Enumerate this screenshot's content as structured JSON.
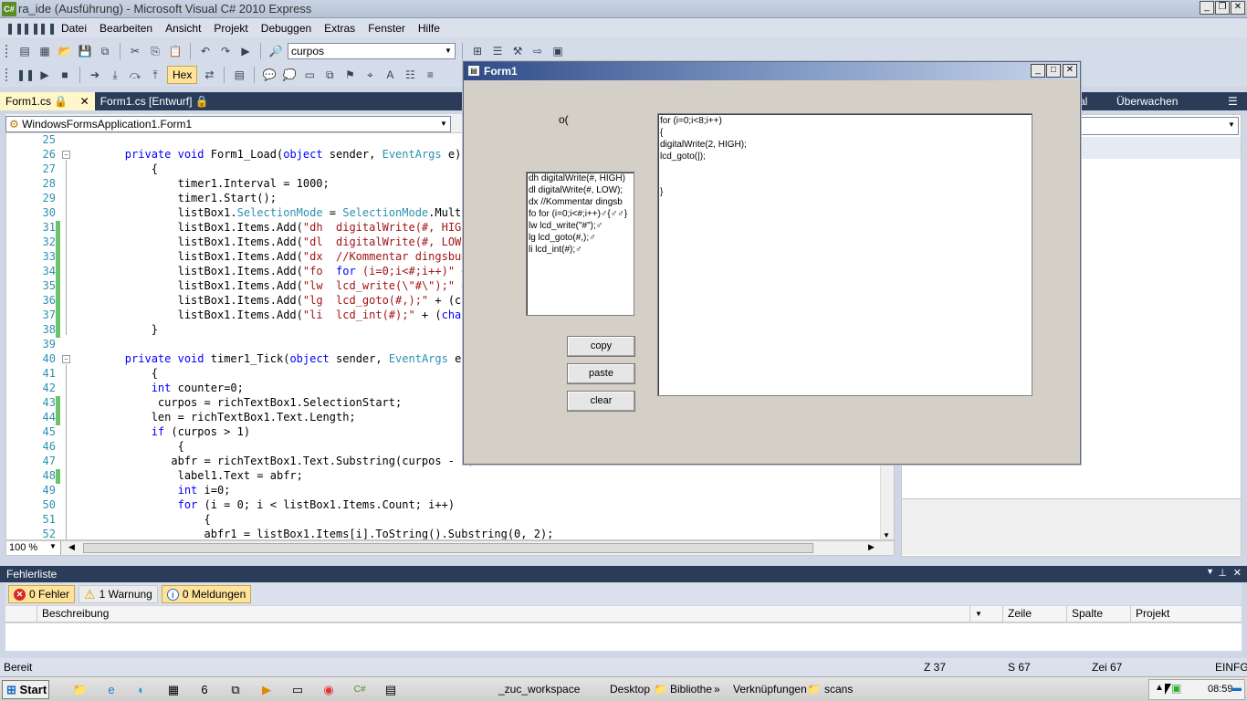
{
  "window": {
    "title": "ra_ide (Ausführung) - Microsoft Visual C# 2010 Express",
    "logo": "C#"
  },
  "menu": [
    "Datei",
    "Bearbeiten",
    "Ansicht",
    "Projekt",
    "Debuggen",
    "Extras",
    "Fenster",
    "Hilfe"
  ],
  "toolbar": {
    "find_value": "curpos",
    "hex_label": "Hex"
  },
  "doc_tabs": [
    {
      "label": "Form1.cs",
      "active": true
    },
    {
      "label": "Form1.cs [Entwurf]",
      "active": false
    }
  ],
  "navigator": {
    "class_combo": "WindowsFormsApplication1.Form1"
  },
  "editor": {
    "zoom": "100 %",
    "lines": [
      {
        "n": "25",
        "code": ""
      },
      {
        "n": "26",
        "code": "        private void Form1_Load(object sender, EventArgs e)"
      },
      {
        "n": "27",
        "code": "            {"
      },
      {
        "n": "28",
        "code": "                timer1.Interval = 1000;"
      },
      {
        "n": "29",
        "code": "                timer1.Start();"
      },
      {
        "n": "30",
        "code": "                listBox1.SelectionMode = SelectionMode.Multi"
      },
      {
        "n": "31",
        "code": "                listBox1.Items.Add(\"dh  digitalWrite(#, HIGH"
      },
      {
        "n": "32",
        "code": "                listBox1.Items.Add(\"dl  digitalWrite(#, LOW)"
      },
      {
        "n": "33",
        "code": "                listBox1.Items.Add(\"dx  //Kommentar dingsbum"
      },
      {
        "n": "34",
        "code": "                listBox1.Items.Add(\"fo  for (i=0;i<#;i++)\" +"
      },
      {
        "n": "35",
        "code": "                listBox1.Items.Add(\"lw  lcd_write(\\\"#\\\");\" +"
      },
      {
        "n": "36",
        "code": "                listBox1.Items.Add(\"lg  lcd_goto(#,);\" + (ch"
      },
      {
        "n": "37",
        "code": "                listBox1.Items.Add(\"li  lcd_int(#);\" + (char"
      },
      {
        "n": "38",
        "code": "            }"
      },
      {
        "n": "39",
        "code": ""
      },
      {
        "n": "40",
        "code": "        private void timer1_Tick(object sender, EventArgs e)"
      },
      {
        "n": "41",
        "code": "            {"
      },
      {
        "n": "42",
        "code": "            int counter=0;"
      },
      {
        "n": "43",
        "code": "             curpos = richTextBox1.SelectionStart;"
      },
      {
        "n": "44",
        "code": "            len = richTextBox1.Text.Length;"
      },
      {
        "n": "45",
        "code": "            if (curpos > 1)"
      },
      {
        "n": "46",
        "code": "                {"
      },
      {
        "n": "47",
        "code": "               abfr = richTextBox1.Text.Substring(curpos - 2,"
      },
      {
        "n": "48",
        "code": "                label1.Text = abfr;"
      },
      {
        "n": "49",
        "code": "                int i=0;"
      },
      {
        "n": "50",
        "code": "                for (i = 0; i < listBox1.Items.Count; i++)"
      },
      {
        "n": "51",
        "code": "                    {"
      },
      {
        "n": "52",
        "code": "                    abfr1 = listBox1.Items[i].ToString().Substring(0, 2);"
      }
    ]
  },
  "right_panel": {
    "tab_partial": "al",
    "tab_watch": "Überwachen"
  },
  "error_list": {
    "title": "Fehlerliste",
    "errors": "0 Fehler",
    "warnings": "1 Warnung",
    "messages": "0 Meldungen",
    "columns": [
      "Beschreibung",
      "Zeile",
      "Spalte",
      "Projekt"
    ]
  },
  "status": {
    "text": "Bereit",
    "line": "Z 37",
    "col": "S 67",
    "char": "Zei 67",
    "mode": "EINFG"
  },
  "form1": {
    "title": "Form1",
    "label1": "o(",
    "listbox_items": [
      "dh  digitalWrite(#, HIGH)",
      "dl  digitalWrite(#, LOW);",
      "dx  //Kommentar dingsb",
      "fo  for (i=0;i<#;i++)♂{♂♂}",
      "lw  lcd_write(\"#\");♂",
      "lg  lcd_goto(#,);♂",
      "li  lcd_int(#);♂"
    ],
    "buttons": {
      "copy": "copy",
      "paste": "paste",
      "clear": "clear"
    },
    "rich_text": [
      "for (i=0;i<8;i++)",
      "{",
      "digitalWrite(2, HIGH);",
      "lcd_goto(|);",
      "",
      "",
      "}"
    ]
  },
  "taskbar": {
    "start": "Start",
    "items": [
      "_zuc_workspace",
      "Desktop",
      "Bibliothe",
      "Verknüpfungen",
      "scans"
    ],
    "clock": "08:59"
  },
  "colors": {
    "keyword": "#0000ff",
    "type": "#2b91af",
    "string": "#a31515",
    "accent": "#2b3c59"
  }
}
